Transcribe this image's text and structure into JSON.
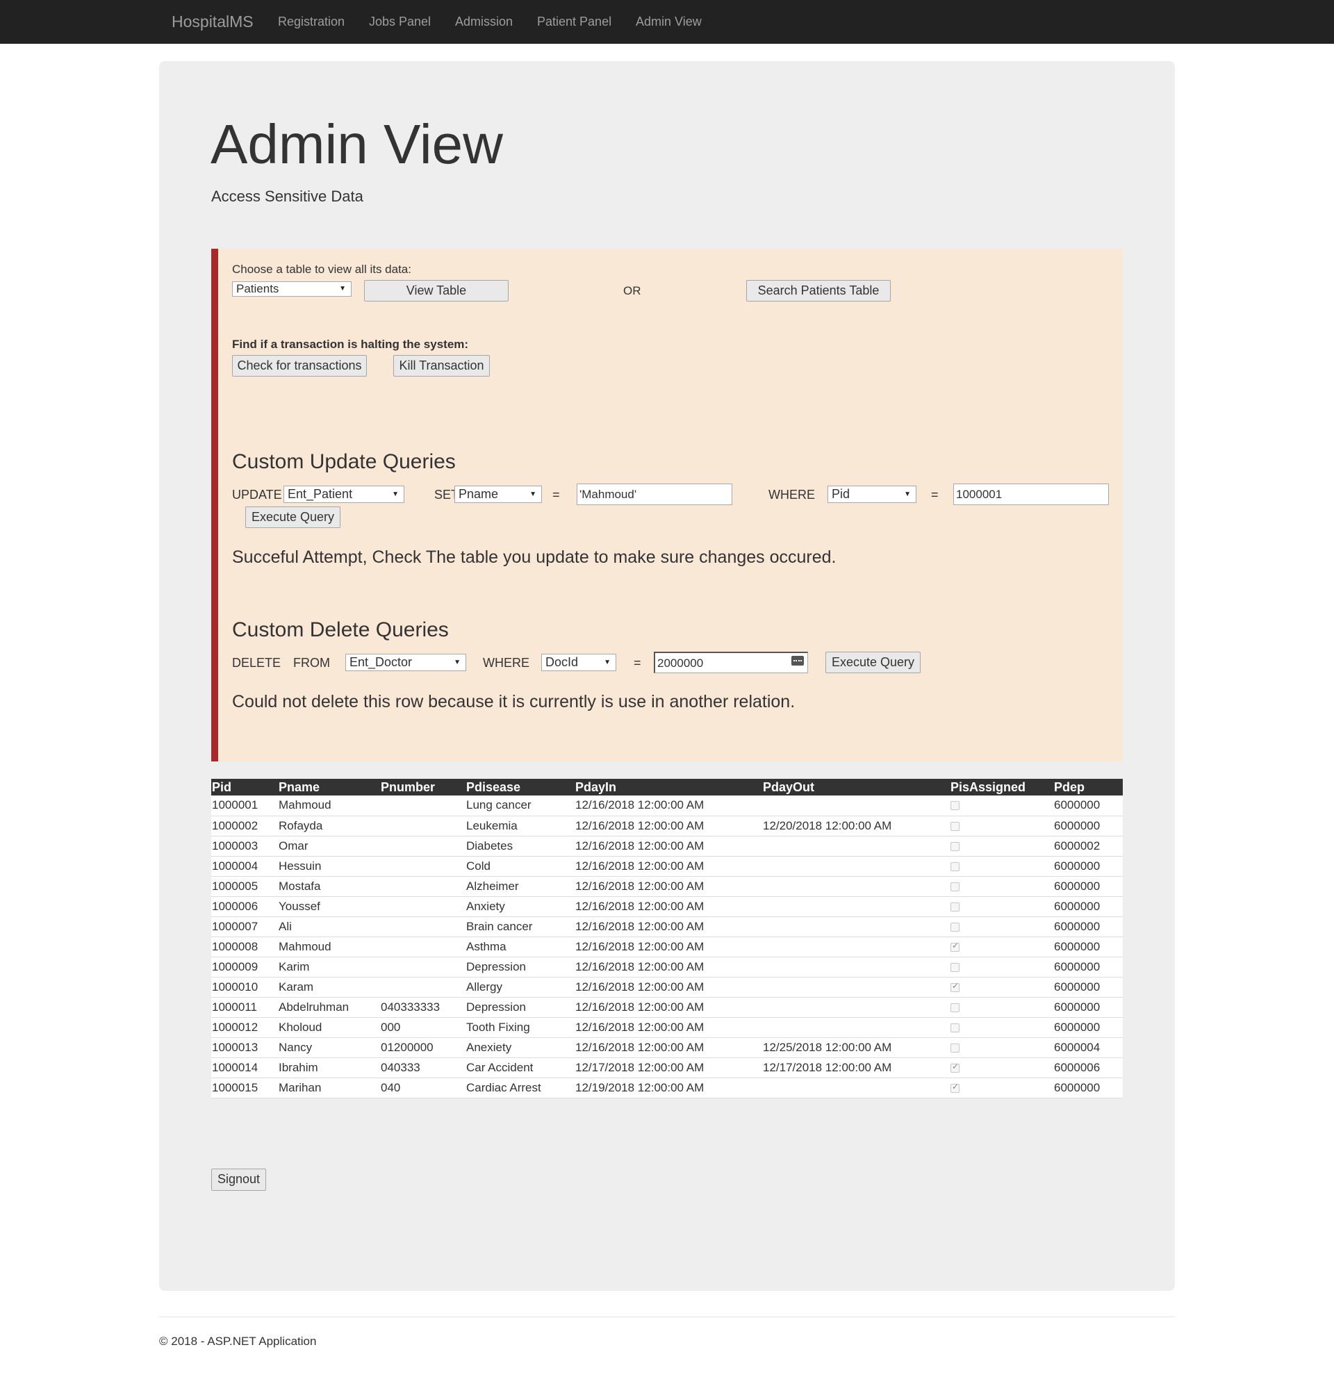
{
  "navbar": {
    "brand": "HospitalMS",
    "links": [
      "Registration",
      "Jobs Panel",
      "Admission",
      "Patient Panel",
      "Admin View"
    ]
  },
  "header": {
    "title": "Admin View",
    "subtitle": "Access Sensitive Data"
  },
  "view_table": {
    "label": "Choose a table to view all its data:",
    "selected_table": "Patients",
    "view_button": "View Table",
    "or_text": "OR",
    "search_button": "Search Patients Table"
  },
  "transactions": {
    "label": "Find if a transaction is halting the system:",
    "check_button": "Check for transactions",
    "kill_button": "Kill Transaction"
  },
  "update_query": {
    "heading": "Custom Update Queries",
    "kw_update": "UPDATE",
    "table": "Ent_Patient",
    "kw_set": "SET",
    "column": "Pname",
    "eq1": "=",
    "value": "'Mahmoud'",
    "kw_where": "WHERE",
    "where_column": "Pid",
    "eq2": "=",
    "where_value": "1000001",
    "execute_button": "Execute Query",
    "result": "Succeful Attempt, Check The table you update to make sure changes occured."
  },
  "delete_query": {
    "heading": "Custom Delete Queries",
    "kw_delete": "DELETE",
    "kw_from": "FROM",
    "table": "Ent_Doctor",
    "kw_where": "WHERE",
    "where_column": "DocId",
    "eq": "=",
    "where_value": "2000000",
    "execute_button": "Execute Query",
    "result": "Could not delete this row because it is currently is use in another relation."
  },
  "patients_table": {
    "columns": [
      "Pid",
      "Pname",
      "Pnumber",
      "Pdisease",
      "PdayIn",
      "PdayOut",
      "PisAssigned",
      "Pdep"
    ],
    "rows": [
      {
        "pid": "1000001",
        "pname": "Mahmoud",
        "pnumber": "",
        "pdisease": "Lung cancer",
        "pdayin": "12/16/2018 12:00:00 AM",
        "pdayout": "",
        "assigned": false,
        "pdep": "6000000"
      },
      {
        "pid": "1000002",
        "pname": "Rofayda",
        "pnumber": "",
        "pdisease": "Leukemia",
        "pdayin": "12/16/2018 12:00:00 AM",
        "pdayout": "12/20/2018 12:00:00 AM",
        "assigned": false,
        "pdep": "6000000"
      },
      {
        "pid": "1000003",
        "pname": "Omar",
        "pnumber": "",
        "pdisease": "Diabetes",
        "pdayin": "12/16/2018 12:00:00 AM",
        "pdayout": "",
        "assigned": false,
        "pdep": "6000002"
      },
      {
        "pid": "1000004",
        "pname": "Hessuin",
        "pnumber": "",
        "pdisease": "Cold",
        "pdayin": "12/16/2018 12:00:00 AM",
        "pdayout": "",
        "assigned": false,
        "pdep": "6000000"
      },
      {
        "pid": "1000005",
        "pname": "Mostafa",
        "pnumber": "",
        "pdisease": "Alzheimer",
        "pdayin": "12/16/2018 12:00:00 AM",
        "pdayout": "",
        "assigned": false,
        "pdep": "6000000"
      },
      {
        "pid": "1000006",
        "pname": "Youssef",
        "pnumber": "",
        "pdisease": "Anxiety",
        "pdayin": "12/16/2018 12:00:00 AM",
        "pdayout": "",
        "assigned": false,
        "pdep": "6000000"
      },
      {
        "pid": "1000007",
        "pname": "Ali",
        "pnumber": "",
        "pdisease": "Brain cancer",
        "pdayin": "12/16/2018 12:00:00 AM",
        "pdayout": "",
        "assigned": false,
        "pdep": "6000000"
      },
      {
        "pid": "1000008",
        "pname": "Mahmoud",
        "pnumber": "",
        "pdisease": "Asthma",
        "pdayin": "12/16/2018 12:00:00 AM",
        "pdayout": "",
        "assigned": true,
        "pdep": "6000000"
      },
      {
        "pid": "1000009",
        "pname": "Karim",
        "pnumber": "",
        "pdisease": "Depression",
        "pdayin": "12/16/2018 12:00:00 AM",
        "pdayout": "",
        "assigned": false,
        "pdep": "6000000"
      },
      {
        "pid": "1000010",
        "pname": "Karam",
        "pnumber": "",
        "pdisease": "Allergy",
        "pdayin": "12/16/2018 12:00:00 AM",
        "pdayout": "",
        "assigned": true,
        "pdep": "6000000"
      },
      {
        "pid": "1000011",
        "pname": "Abdelruhman",
        "pnumber": "040333333",
        "pdisease": "Depression",
        "pdayin": "12/16/2018 12:00:00 AM",
        "pdayout": "",
        "assigned": false,
        "pdep": "6000000"
      },
      {
        "pid": "1000012",
        "pname": "Kholoud",
        "pnumber": "000",
        "pdisease": "Tooth Fixing",
        "pdayin": "12/16/2018 12:00:00 AM",
        "pdayout": "",
        "assigned": false,
        "pdep": "6000000"
      },
      {
        "pid": "1000013",
        "pname": "Nancy",
        "pnumber": "01200000",
        "pdisease": "Anexiety",
        "pdayin": "12/16/2018 12:00:00 AM",
        "pdayout": "12/25/2018 12:00:00 AM",
        "assigned": false,
        "pdep": "6000004"
      },
      {
        "pid": "1000014",
        "pname": "Ibrahim",
        "pnumber": "040333",
        "pdisease": "Car Accident",
        "pdayin": "12/17/2018 12:00:00 AM",
        "pdayout": "12/17/2018 12:00:00 AM",
        "assigned": true,
        "pdep": "6000006"
      },
      {
        "pid": "1000015",
        "pname": "Marihan",
        "pnumber": "040",
        "pdisease": "Cardiac Arrest",
        "pdayin": "12/19/2018 12:00:00 AM",
        "pdayout": "",
        "assigned": true,
        "pdep": "6000000"
      }
    ]
  },
  "signout_button": "Signout",
  "footer": "© 2018 - ASP.NET Application",
  "colors": {
    "navbar_bg": "#222222",
    "jumbotron_bg": "#eeeeee",
    "panel_bg": "#f9e8d6",
    "panel_border": "#a72a2a",
    "table_header_bg": "#333333"
  }
}
